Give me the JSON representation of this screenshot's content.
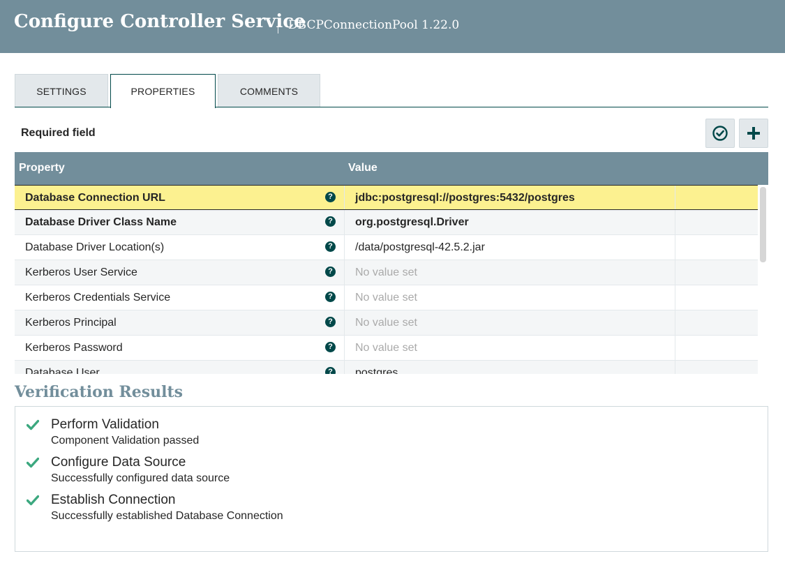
{
  "header": {
    "title": "Configure Controller Service",
    "subtitle": "DBCPConnectionPool 1.22.0"
  },
  "tabs": [
    {
      "label": "SETTINGS",
      "active": false
    },
    {
      "label": "PROPERTIES",
      "active": true
    },
    {
      "label": "COMMENTS",
      "active": false
    }
  ],
  "toolbar": {
    "required_label": "Required field",
    "verify_icon": "check-circle-icon",
    "add_icon": "plus-icon"
  },
  "grid": {
    "columns": {
      "property": "Property",
      "value": "Value"
    },
    "rows": [
      {
        "name": "Database Connection URL",
        "value": "jdbc:postgresql://postgres:5432/postgres",
        "required": true,
        "selected": true
      },
      {
        "name": "Database Driver Class Name",
        "value": "org.postgresql.Driver",
        "required": true
      },
      {
        "name": "Database Driver Location(s)",
        "value": "/data/postgresql-42.5.2.jar",
        "required": false
      },
      {
        "name": "Kerberos User Service",
        "value": "No value set",
        "required": false,
        "unset": true
      },
      {
        "name": "Kerberos Credentials Service",
        "value": "No value set",
        "required": false,
        "unset": true
      },
      {
        "name": "Kerberos Principal",
        "value": "No value set",
        "required": false,
        "unset": true
      },
      {
        "name": "Kerberos Password",
        "value": "No value set",
        "required": false,
        "unset": true
      },
      {
        "name": "Database User",
        "value": "postgres",
        "required": false
      }
    ]
  },
  "verification": {
    "title": "Verification Results",
    "items": [
      {
        "name": "Perform Validation",
        "message": "Component Validation passed",
        "status": "success"
      },
      {
        "name": "Configure Data Source",
        "message": "Successfully configured data source",
        "status": "success"
      },
      {
        "name": "Establish Connection",
        "message": "Successfully established Database Connection",
        "status": "success"
      }
    ]
  },
  "colors": {
    "header": "#728e9b",
    "accent": "#004849",
    "selected_row": "#fcf190",
    "success": "#3ca87f"
  }
}
